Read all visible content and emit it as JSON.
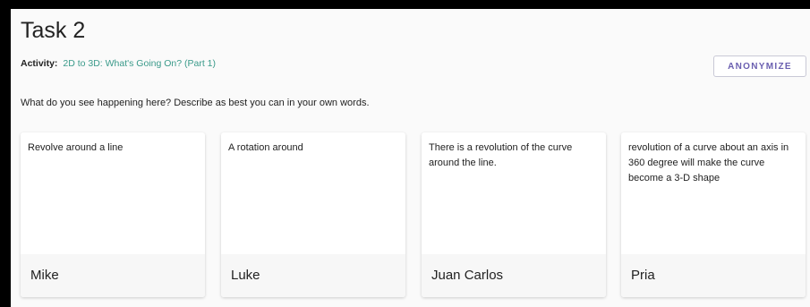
{
  "task": {
    "title": "Task 2"
  },
  "activity": {
    "label": "Activity:",
    "name": "2D to 3D: What's Going On? (Part 1)"
  },
  "anonymize_label": "ANONYMIZE",
  "prompt": "What do you see happening here? Describe as best you can in your own words.",
  "responses": [
    {
      "text": "Revolve around a line",
      "name": "Mike"
    },
    {
      "text": "A rotation around",
      "name": "Luke"
    },
    {
      "text": "There is a revolution of the curve around the line.",
      "name": "Juan Carlos"
    },
    {
      "text": "revolution of a curve about an axis in 360 degree will make the curve become a 3-D shape",
      "name": "Pria"
    }
  ]
}
